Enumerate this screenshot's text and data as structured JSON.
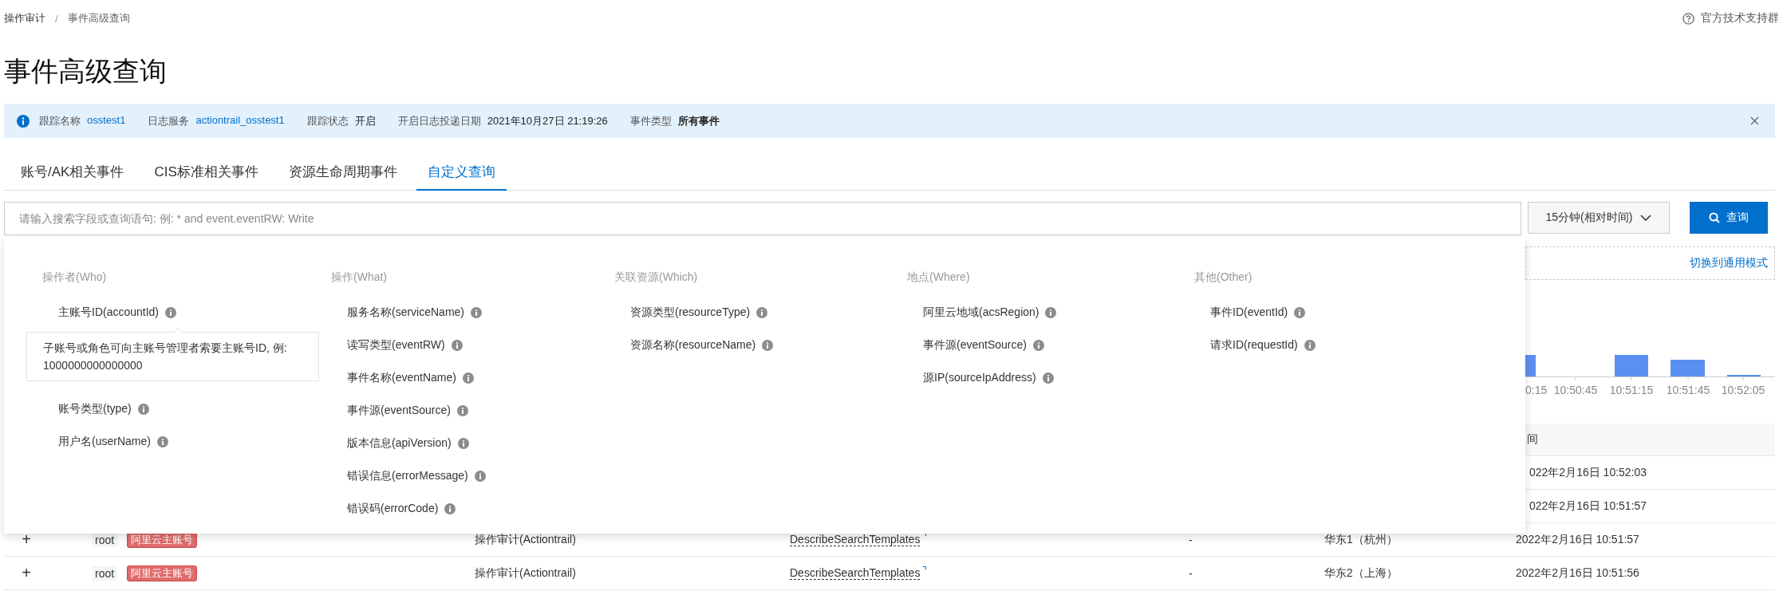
{
  "breadcrumb": {
    "items": [
      "操作审计",
      "事件高级查询"
    ],
    "separator": "/"
  },
  "help_link": "官方技术支持群",
  "page_title": "事件高级查询",
  "banner": {
    "fields": [
      {
        "label": "跟踪名称",
        "value": "osstest1",
        "kind": "link"
      },
      {
        "label": "日志服务",
        "value": "actiontrail_osstest1",
        "kind": "link"
      },
      {
        "label": "跟踪状态",
        "value": "开启",
        "kind": "text"
      },
      {
        "label": "开启日志投递日期",
        "value": "2021年10月27日 21:19:26",
        "kind": "text"
      },
      {
        "label": "事件类型",
        "value": "所有事件",
        "kind": "strong"
      }
    ]
  },
  "tabs": [
    {
      "label": "账号/AK相关事件",
      "selected": false
    },
    {
      "label": "CIS标准相关事件",
      "selected": false
    },
    {
      "label": "资源生命周期事件",
      "selected": false
    },
    {
      "label": "自定义查询",
      "selected": true
    }
  ],
  "search": {
    "placeholder": "请输入搜索字段或查询语句: 例: * and event.eventRW: Write"
  },
  "time_range": "15分钟(相对时间)",
  "query_button": "查询",
  "mode_switch_link": "切换到通用模式",
  "chart": {
    "tick_labels": [
      "0:15",
      "10:50:45",
      "10:51:15",
      "10:51:45",
      "10:52:05"
    ]
  },
  "table": {
    "header_visible": "间",
    "rows": [
      {
        "kind": "partial",
        "time": "022年2月16日 10:52:03"
      },
      {
        "kind": "partial",
        "time": "022年2月16日 10:51:57"
      },
      {
        "kind": "full",
        "expand": "+",
        "user": "root",
        "account_tag": "阿里云主账号",
        "service": "操作审计(Actiontrail)",
        "api": "DescribeSearchTemplates",
        "error": "-",
        "region": "华东1（杭州）",
        "time": "2022年2月16日 10:51:57"
      },
      {
        "kind": "full",
        "expand": "+",
        "user": "root",
        "account_tag": "阿里云主账号",
        "service": "操作审计(Actiontrail)",
        "api": "DescribeSearchTemplates",
        "error": "-",
        "region": "华东2（上海）",
        "time": "2022年2月16日 10:51:56"
      }
    ]
  },
  "field_dropdown": {
    "columns": [
      {
        "title": "操作者(Who)",
        "fields": [
          {
            "label": "主账号ID(accountId)",
            "tooltip": "子账号或角色可向主账号管理者索要主账号ID, 例: 1000000000000000"
          },
          {
            "label": "账号类型(type)"
          },
          {
            "label": "用户名(userName)"
          }
        ]
      },
      {
        "title": "操作(What)",
        "fields": [
          {
            "label": "服务名称(serviceName)"
          },
          {
            "label": "读写类型(eventRW)"
          },
          {
            "label": "事件名称(eventName)"
          },
          {
            "label": "事件源(eventSource)"
          },
          {
            "label": "版本信息(apiVersion)"
          },
          {
            "label": "错误信息(errorMessage)"
          },
          {
            "label": "错误码(errorCode)"
          }
        ]
      },
      {
        "title": "关联资源(Which)",
        "fields": [
          {
            "label": "资源类型(resourceType)"
          },
          {
            "label": "资源名称(resourceName)"
          }
        ]
      },
      {
        "title": "地点(Where)",
        "fields": [
          {
            "label": "阿里云地域(acsRegion)"
          },
          {
            "label": "事件源(eventSource)"
          },
          {
            "label": "源IP(sourceIpAddress)"
          }
        ]
      },
      {
        "title": "其他(Other)",
        "fields": [
          {
            "label": "事件ID(eventId)"
          },
          {
            "label": "请求ID(requestId)"
          }
        ]
      }
    ]
  }
}
